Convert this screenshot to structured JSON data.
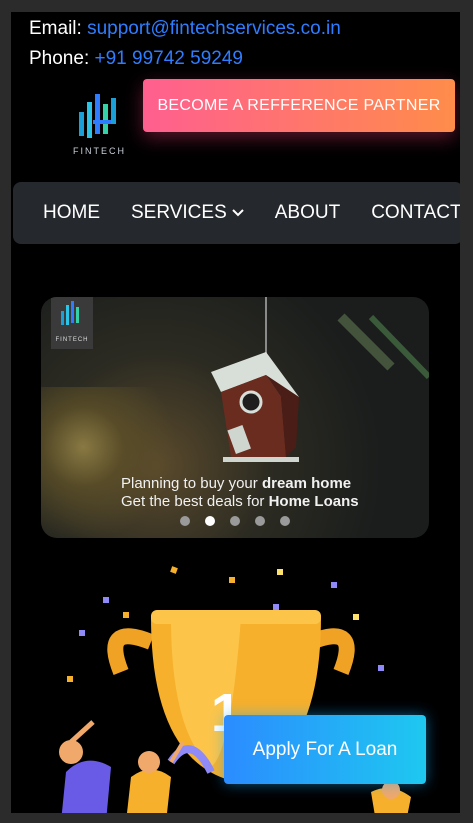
{
  "contact": {
    "email_label": "Email:",
    "email_value": "support@fintechservices.co.in",
    "phone_label": "Phone:",
    "phone_value": "+91 99742 59249"
  },
  "brand": {
    "logo_text": "FINTECH"
  },
  "header": {
    "ref_button_label": "BECOME A REFFERENCE PARTNER"
  },
  "nav": {
    "items": [
      {
        "label": "HOME"
      },
      {
        "label": "SERVICES"
      },
      {
        "label": "ABOUT"
      },
      {
        "label": "CONTACT"
      }
    ]
  },
  "slider": {
    "logo_text": "FINTECH",
    "line1_prefix": "Planning to buy your ",
    "line1_bold": "dream home",
    "line2_prefix": "Get the best deals for ",
    "line2_bold": "Home Loans",
    "dot_count": 5,
    "active_index": 1
  },
  "hero": {
    "trophy_number": "1"
  },
  "cta": {
    "apply_label": "Apply For A Loan"
  },
  "colors": {
    "link": "#2f7dff",
    "ref_gradient_start": "#ff5f8f",
    "ref_gradient_end": "#ff8c4a",
    "nav_bg": "#25282c",
    "apply_gradient_start": "#2b8cff",
    "apply_gradient_end": "#1ec8f0",
    "trophy": "#f7b02b"
  }
}
